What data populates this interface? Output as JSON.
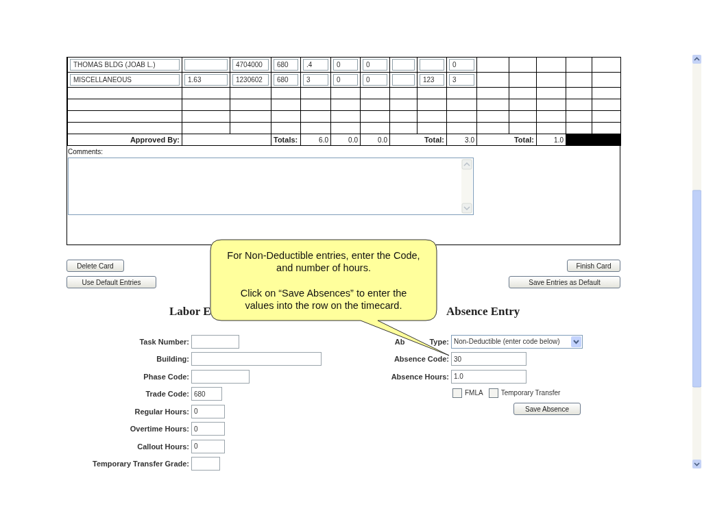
{
  "table": {
    "rows": [
      {
        "kind": "entry",
        "cells": [
          {
            "kind": "input",
            "value": "THOMAS BLDG (JOAB L.)"
          },
          {
            "kind": "input"
          },
          {
            "kind": "input",
            "value": "4704000"
          },
          {
            "kind": "input",
            "value": "680"
          },
          {
            "kind": "input",
            "value": ".4"
          },
          {
            "kind": "input",
            "value": "0"
          },
          {
            "kind": "input",
            "value": "0"
          },
          {
            "kind": "input"
          },
          {
            "kind": "input"
          },
          {
            "kind": "input",
            "value": "0"
          },
          {
            "kind": "empty"
          },
          {
            "kind": "empty"
          },
          {
            "kind": "empty"
          },
          {
            "kind": "empty"
          },
          {
            "kind": "empty"
          }
        ]
      },
      {
        "kind": "entry",
        "cells": [
          {
            "kind": "input",
            "value": "MISCELLANEOUS"
          },
          {
            "kind": "input",
            "value": "1.63"
          },
          {
            "kind": "input",
            "value": "1230602"
          },
          {
            "kind": "input",
            "value": "680"
          },
          {
            "kind": "input",
            "value": "3"
          },
          {
            "kind": "input",
            "value": "0"
          },
          {
            "kind": "input",
            "value": "0"
          },
          {
            "kind": "input"
          },
          {
            "kind": "input",
            "value": "123"
          },
          {
            "kind": "input",
            "value": "3"
          },
          {
            "kind": "empty"
          },
          {
            "kind": "empty"
          },
          {
            "kind": "empty"
          },
          {
            "kind": "empty"
          },
          {
            "kind": "empty"
          }
        ]
      },
      {
        "kind": "blank"
      },
      {
        "kind": "blank"
      },
      {
        "kind": "blank"
      },
      {
        "kind": "blank"
      }
    ],
    "totals": {
      "approved_label": "Approved By:",
      "totals_label": "Totals:",
      "values": [
        "6.0",
        "0.0",
        "0.0"
      ],
      "absence_label": "Total:",
      "absence_total": "3.0",
      "transfer_label": "Total:",
      "transfer_total": "1.0"
    }
  },
  "comments": {
    "label": "Comments:"
  },
  "buttons": {
    "left": [
      "Delete Card",
      "Use Default Entries"
    ],
    "right": [
      "Finish Card",
      "Save Entries as Default"
    ]
  },
  "labor": {
    "title": "Labor E",
    "fields": [
      {
        "label": "Task Number:"
      },
      {
        "label": "Building:"
      },
      {
        "label": "Phase Code:"
      },
      {
        "label": "Trade Code:",
        "value": "680"
      },
      {
        "label": "Regular Hours:",
        "value": "0"
      },
      {
        "label": "Overtime Hours:",
        "value": "0"
      },
      {
        "label": "Callout Hours:",
        "value": "0"
      },
      {
        "label": "Temporary Transfer Grade:"
      }
    ]
  },
  "absence": {
    "title": "Absence Entry",
    "type": {
      "label_parts": [
        "Ab",
        "Type:"
      ],
      "value": "Non-Deductible (enter code below)"
    },
    "fields": [
      {
        "label": "Absence Code:",
        "value": "30"
      },
      {
        "label": "Absence Hours:",
        "value": "1.0"
      }
    ],
    "checkboxes": [
      {
        "label": "FMLA",
        "checked": false
      },
      {
        "label": "Temporary Transfer",
        "checked": false
      }
    ],
    "save_button": "Save Absence"
  },
  "callout": {
    "paragraphs": [
      "For Non-Deductible entries, enter the Code, and number of hours.",
      "Click on “Save Absences” to enter the values into the row on the timecard."
    ]
  }
}
